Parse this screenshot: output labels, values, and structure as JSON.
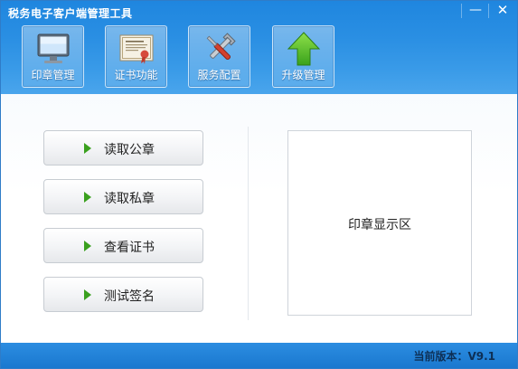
{
  "window": {
    "title": "税务电子客户端管理工具",
    "minimize_glyph": "—",
    "close_glyph": "✕"
  },
  "toolbar": {
    "items": [
      {
        "label": "印章管理",
        "icon": "monitor-icon"
      },
      {
        "label": "证书功能",
        "icon": "certificate-icon"
      },
      {
        "label": "服务配置",
        "icon": "tools-icon"
      },
      {
        "label": "升级管理",
        "icon": "up-arrow-icon"
      }
    ]
  },
  "actions": [
    {
      "label": "读取公章"
    },
    {
      "label": "读取私章"
    },
    {
      "label": "查看证书"
    },
    {
      "label": "测试签名"
    }
  ],
  "seal_area": {
    "label": "印章显示区"
  },
  "footer": {
    "version_text": "当前版本：V9.1"
  },
  "colors": {
    "header": "#2a8fe3",
    "accent_triangle": "#3aa01e",
    "footer": "#1a78cf"
  }
}
